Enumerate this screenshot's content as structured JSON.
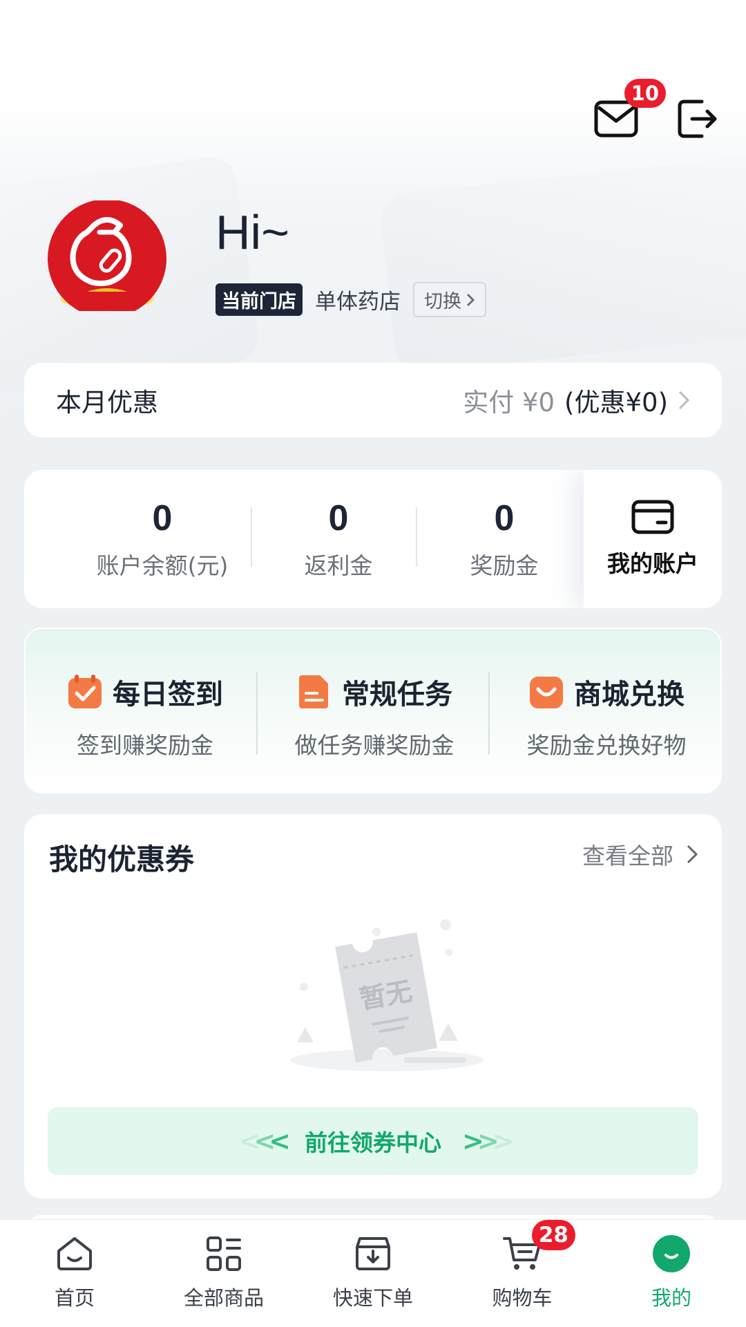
{
  "header": {
    "mail_badge": "10"
  },
  "profile": {
    "greeting": "Hi~",
    "store_tag": "当前门店",
    "store_name": "单体药店",
    "switch_label": "切换"
  },
  "monthly": {
    "title": "本月优惠",
    "paid": "实付 ¥0",
    "discount": "(优惠¥0)"
  },
  "account": {
    "stats": [
      {
        "value": "0",
        "label": "账户余额(元)"
      },
      {
        "value": "0",
        "label": "返利金"
      },
      {
        "value": "0",
        "label": "奖励金"
      }
    ],
    "my_account_label": "我的账户"
  },
  "tasks": [
    {
      "title": "每日签到",
      "subtitle": "签到赚奖励金",
      "icon": "calendar-check-icon"
    },
    {
      "title": "常规任务",
      "subtitle": "做任务赚奖励金",
      "icon": "document-icon"
    },
    {
      "title": "商城兑换",
      "subtitle": "奖励金兑换好物",
      "icon": "shopping-bag-icon"
    }
  ],
  "coupons": {
    "title": "我的优惠券",
    "view_all": "查看全部",
    "empty_text": "暂无",
    "goto_label": "前往领券中心"
  },
  "bottom_nav": {
    "items": [
      {
        "label": "首页",
        "icon": "home-icon"
      },
      {
        "label": "全部商品",
        "icon": "grid-icon"
      },
      {
        "label": "快速下单",
        "icon": "quick-order-icon"
      },
      {
        "label": "购物车",
        "icon": "cart-icon"
      },
      {
        "label": "我的",
        "icon": "profile-icon"
      }
    ],
    "cart_badge": "28",
    "active_index": 4
  },
  "colors": {
    "accent_green": "#12a86b",
    "badge_red": "#ea1d2c",
    "task_orange": "#f26a3c"
  }
}
